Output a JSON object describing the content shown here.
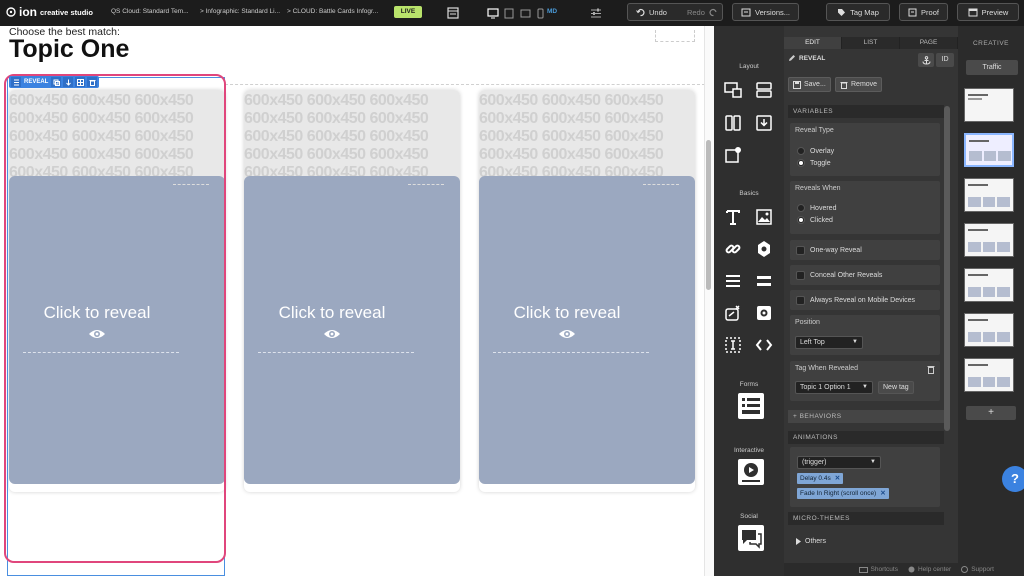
{
  "topbar": {
    "logo_mark": "ion",
    "logo_text": "creative studio",
    "crumbs": [
      "QS Cloud: Standard Tem...",
      "> Infographic: Standard Li...",
      "> CLOUD: Battle Cards Infogr..."
    ],
    "live": "LIVE",
    "device_size": "MD",
    "undo": "Undo",
    "redo": "Redo",
    "versions": "Versions...",
    "tagmap": "Tag Map",
    "proof": "Proof",
    "preview": "Preview"
  },
  "canvas": {
    "subtitle": "Choose the best match:",
    "title": "Topic One",
    "placeholder_text": "600x450 600x450 600x450",
    "reveal_tag": "REVEAL",
    "cards": [
      {
        "label": "Click to reveal"
      },
      {
        "label": "Click to reveal"
      },
      {
        "label": "Click to reveal"
      }
    ]
  },
  "tools": {
    "layout": "Layout",
    "basics": "Basics",
    "forms": "Forms",
    "interactive": "Interactive",
    "social": "Social"
  },
  "panel": {
    "tabs": [
      "EDIT",
      "LIST",
      "PAGE"
    ],
    "header": "REVEAL",
    "id_label": "ID",
    "save": "Save...",
    "remove": "Remove",
    "variables": "VARIABLES",
    "reveal_type": {
      "label": "Reveal Type",
      "options": [
        "Overlay",
        "Toggle"
      ],
      "selected": "Toggle"
    },
    "reveals_when": {
      "label": "Reveals When",
      "options": [
        "Hovered",
        "Clicked"
      ],
      "selected": "Clicked"
    },
    "checkboxes": [
      "One-way Reveal",
      "Conceal Other Reveals",
      "Always Reveal on Mobile Devices"
    ],
    "position": {
      "label": "Position",
      "value": "Left Top"
    },
    "tag_when_revealed": {
      "label": "Tag When Revealed",
      "value": "Topic 1 Option 1",
      "new_tag": "New tag"
    },
    "behaviors": "+ BEHAVIORS",
    "animations": "ANIMATIONS",
    "trigger": "(trigger)",
    "chips": [
      "Delay 0.4s",
      "Fade In Right (scroll once)"
    ],
    "micro_themes": "MICRO-THEMES",
    "others": "Others"
  },
  "creative": {
    "label": "CREATIVE",
    "traffic": "Traffic",
    "add": "+"
  },
  "help": "?",
  "bottombar": {
    "shortcuts": "Shortcuts",
    "help_center": "Help center",
    "support": "Support"
  },
  "colors": {
    "accent_blue": "#3b82e0",
    "selection_pink": "#e0467c",
    "live_green": "#b9e36b",
    "reveal_cover": "#9ba8c0"
  }
}
